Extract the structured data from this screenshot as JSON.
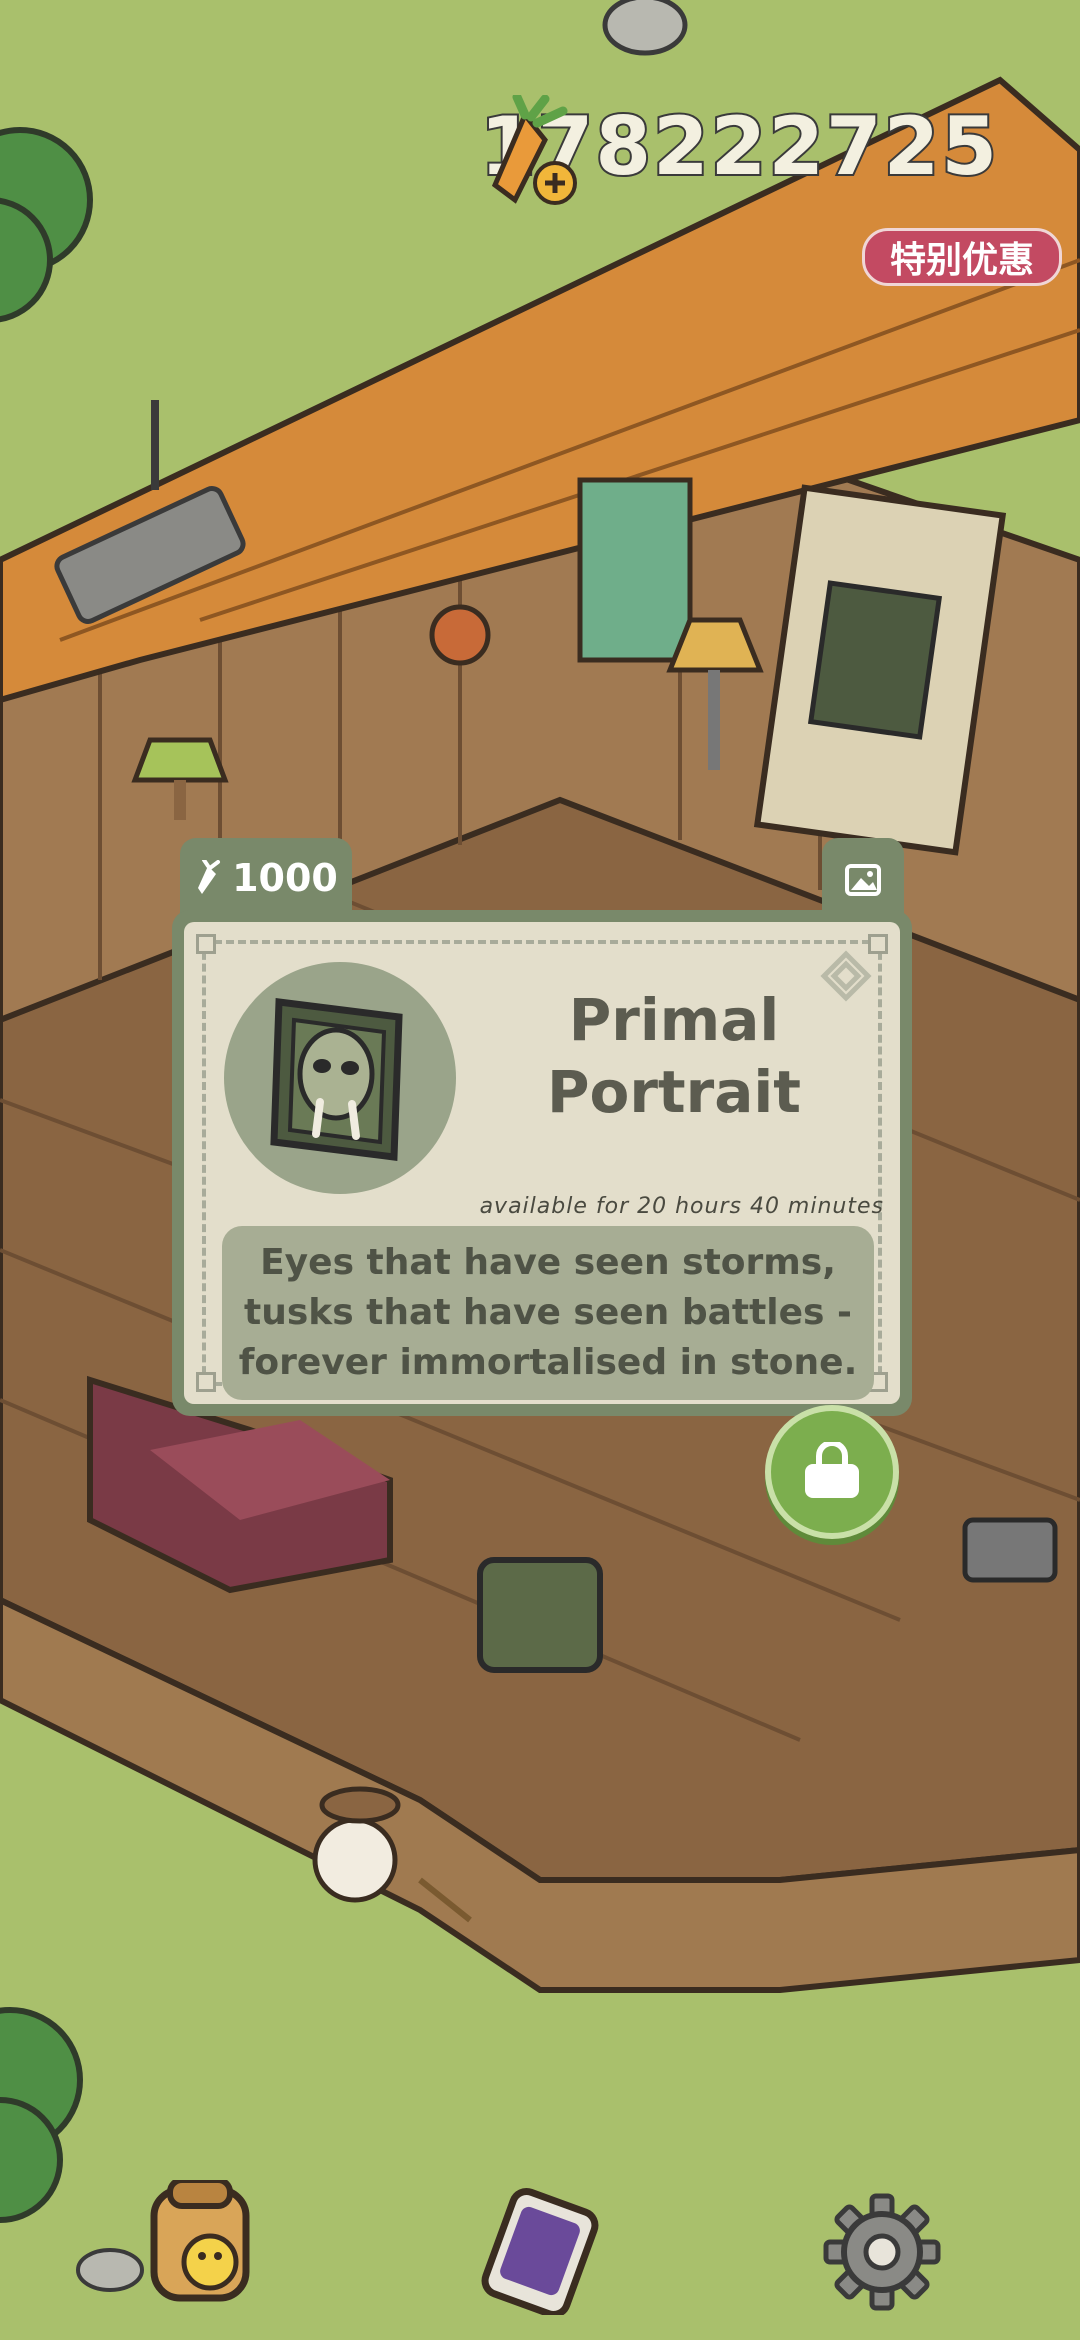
{
  "hud": {
    "carrot_count": "178222725",
    "special_offer_label": "特别优惠",
    "add_icon": "plus-icon"
  },
  "item_card": {
    "price": "1000",
    "price_icon": "carrot-icon",
    "photo_icon": "photo-icon",
    "title": "Primal Portrait",
    "availability": "available for 20 hours 40 minutes",
    "description": "Eyes that have seen storms, tusks that have seen battles - forever immortalised in stone.",
    "buy_icon": "shopping-bag-icon"
  },
  "bottom_bar": {
    "left_icon": "backpack-chick-icon",
    "middle_icon": "phone-icon",
    "right_icon": "gear-icon"
  },
  "colors": {
    "grass": "#a9c06c",
    "card_frame": "#79896a",
    "card_bg": "#e3decb",
    "badge": "#c34a62",
    "buy_button": "#7cae4e"
  }
}
